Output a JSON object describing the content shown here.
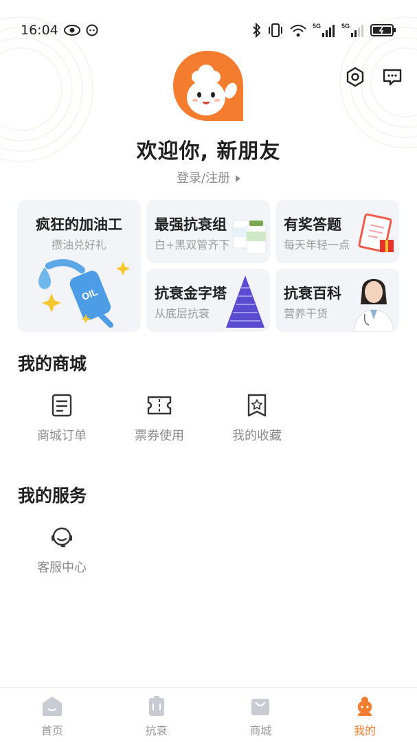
{
  "status_bar": {
    "time": "16:04",
    "net1": "5G",
    "net2": "5G"
  },
  "colors": {
    "accent": "#f47c2e",
    "text_primary": "#1f1f1f",
    "text_secondary": "#8a8a8a",
    "card_bg": "#f3f4f8"
  },
  "header": {
    "actions": [
      {
        "icon": "hexagon-settings-icon"
      },
      {
        "icon": "message-icon"
      }
    ],
    "welcome": "欢迎你, 新朋友",
    "login_label": "登录/注册"
  },
  "promo_cards": [
    {
      "title": "疯狂的加油工",
      "subtitle": "攒油兑好礼",
      "icon": "fuel-nozzle-icon"
    },
    {
      "title": "最强抗衰组",
      "subtitle": "白+黑双管齐下",
      "icon": "supplement-bottles-icon"
    },
    {
      "title": "有奖答题",
      "subtitle": "每天年轻一点",
      "icon": "quiz-clipboard-icon"
    },
    {
      "title": "抗衰金字塔",
      "subtitle": "从底层抗衰",
      "icon": "pyramid-icon"
    },
    {
      "title": "抗衰百科",
      "subtitle": "营养干货",
      "icon": "doctor-icon"
    }
  ],
  "mall_section": {
    "title": "我的商城",
    "items": [
      {
        "label": "商城订单",
        "icon": "order-icon"
      },
      {
        "label": "票券使用",
        "icon": "ticket-icon"
      },
      {
        "label": "我的收藏",
        "icon": "favorite-icon"
      }
    ]
  },
  "service_section": {
    "title": "我的服务",
    "items": [
      {
        "label": "客服中心",
        "icon": "customer-service-icon"
      }
    ]
  },
  "tab_bar": {
    "tabs": [
      {
        "label": "首页",
        "icon": "home-icon",
        "active": false
      },
      {
        "label": "抗衰",
        "icon": "antiaging-icon",
        "active": false
      },
      {
        "label": "商城",
        "icon": "shop-bag-icon",
        "active": false
      },
      {
        "label": "我的",
        "icon": "profile-icon",
        "active": true
      }
    ]
  }
}
